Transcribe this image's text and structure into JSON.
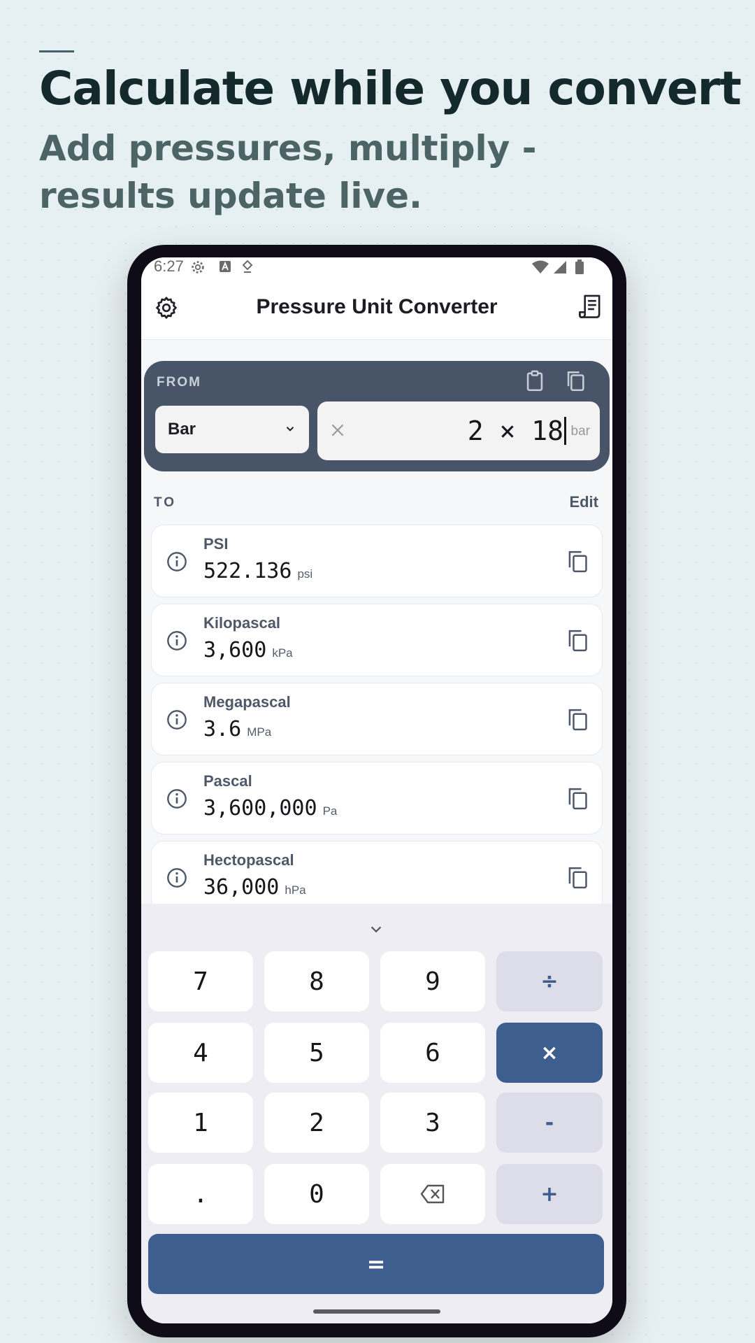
{
  "promo": {
    "headline": "Calculate while you convert",
    "subheadline": "Add pressures, multiply - results update live."
  },
  "status_bar": {
    "time": "6:27",
    "left_icons": [
      "settings-gear-icon",
      "a-badge-icon",
      "location-icon"
    ],
    "right_icons": [
      "wifi-icon",
      "signal-icon",
      "battery-icon"
    ]
  },
  "app_bar": {
    "title": "Pressure Unit Converter",
    "left_icon": "settings-icon",
    "right_icon": "receipt-icon"
  },
  "from": {
    "label": "FROM",
    "unit": "Bar",
    "expression": "2 × 18",
    "unit_suffix": "bar",
    "icons": [
      "clipboard-icon",
      "copy-icon",
      "clear-icon"
    ]
  },
  "to": {
    "label": "TO",
    "edit_label": "Edit",
    "results": [
      {
        "name": "PSI",
        "value": "522.136",
        "unit": "psi"
      },
      {
        "name": "Kilopascal",
        "value": "3,600",
        "unit": "kPa"
      },
      {
        "name": "Megapascal",
        "value": "3.6",
        "unit": "MPa"
      },
      {
        "name": "Pascal",
        "value": "3,600,000",
        "unit": "Pa"
      },
      {
        "name": "Hectopascal",
        "value": "36,000",
        "unit": "hPa"
      }
    ]
  },
  "keypad": {
    "collapse_icon": "chevron-down-icon",
    "keys": {
      "k7": "7",
      "k8": "8",
      "k9": "9",
      "div": "÷",
      "k4": "4",
      "k5": "5",
      "k6": "6",
      "mul": "×",
      "k1": "1",
      "k2": "2",
      "k3": "3",
      "sub": "-",
      "dot": ".",
      "k0": "0",
      "add": "+",
      "eq": "="
    },
    "backspace_icon": "backspace-icon",
    "active_operator": "×",
    "colors": {
      "accent": "#3d5e8e",
      "operator_bg": "#dcdde8",
      "from_card": "#485569"
    }
  }
}
